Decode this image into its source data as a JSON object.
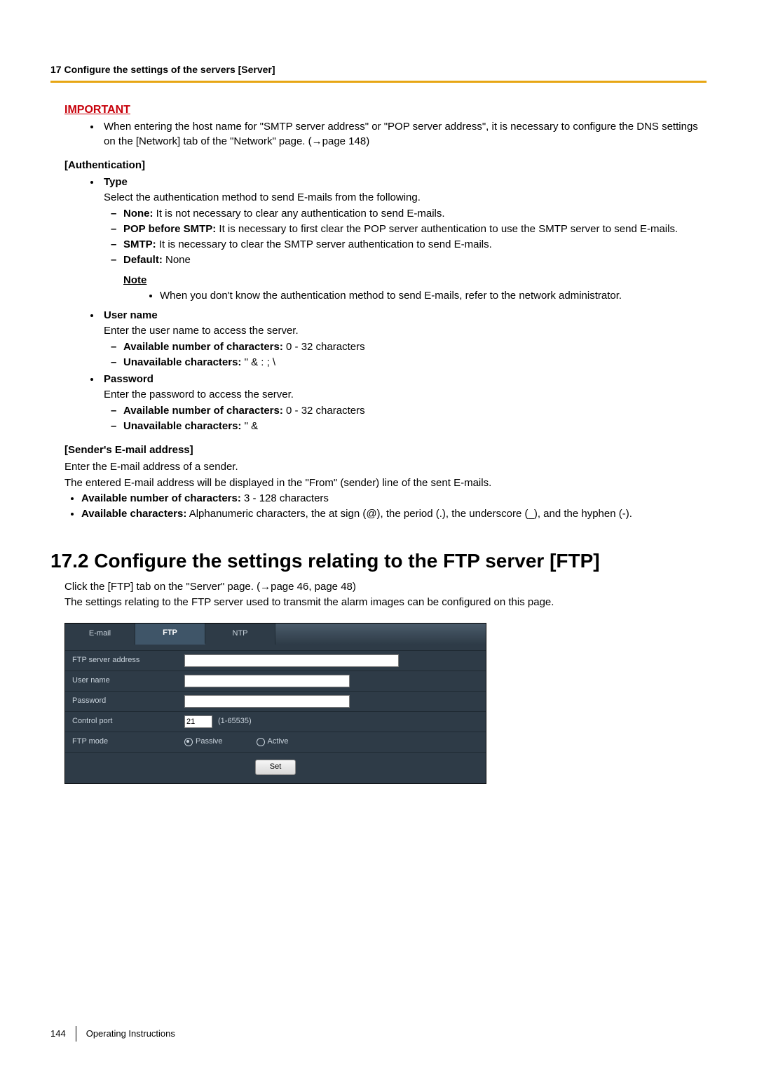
{
  "header": {
    "running": "17 Configure the settings of the servers [Server]"
  },
  "important": {
    "title": "IMPORTANT",
    "item1": "When entering the host name for \"SMTP server address\" or \"POP server address\", it is necessary to configure the DNS settings on the [Network] tab of the \"Network\" page. (→page 148)"
  },
  "auth": {
    "heading": "[Authentication]",
    "type_label": "Type",
    "type_desc": "Select the authentication method to send E-mails from the following.",
    "none_b": "None:",
    "none_t": " It is not necessary to clear any authentication to send E-mails.",
    "pop_b": "POP before SMTP:",
    "pop_t": " It is necessary to first clear the POP server authentication to use the SMTP server to send E-mails.",
    "smtp_b": "SMTP:",
    "smtp_t": " It is necessary to clear the SMTP server authentication to send E-mails.",
    "def_b": "Default:",
    "def_t": " None",
    "note_head": "Note",
    "note_item": "When you don't know the authentication method to send E-mails, refer to the network administrator.",
    "user_label": "User name",
    "user_desc": "Enter the user name to access the server.",
    "avail_b": "Available number of characters:",
    "avail_t": " 0 - 32 characters",
    "unavail_b": "Unavailable characters:",
    "unavail_user_t": " \" & : ; \\",
    "pass_label": "Password",
    "pass_desc": "Enter the password to access the server.",
    "unavail_pass_t": " \" &"
  },
  "sender": {
    "heading": "[Sender's E-mail address]",
    "p1": "Enter the E-mail address of a sender.",
    "p2": "The entered E-mail address will be displayed in the \"From\" (sender) line of the sent E-mails.",
    "a1_b": "Available number of characters:",
    "a1_t": " 3 - 128 characters",
    "a2_b": "Available characters:",
    "a2_t": " Alphanumeric characters, the at sign (@), the period (.), the underscore (_), and the hyphen (-)."
  },
  "h2": "17.2  Configure the settings relating to the FTP server [FTP]",
  "ftp_intro": {
    "p1": "Click the [FTP] tab on the \"Server\" page. (→page 46, page 48)",
    "p2": "The settings relating to the FTP server used to transmit the alarm images can be configured on this page."
  },
  "ftp_ui": {
    "tabs": {
      "email": "E-mail",
      "ftp": "FTP",
      "ntp": "NTP"
    },
    "rows": {
      "addr": "FTP server address",
      "user": "User name",
      "pass": "Password",
      "port": "Control port",
      "mode": "FTP mode"
    },
    "port_value": "21",
    "port_hint": "(1-65535)",
    "mode_passive": "Passive",
    "mode_active": "Active",
    "set": "Set"
  },
  "footer": {
    "page": "144",
    "text": "Operating Instructions"
  }
}
